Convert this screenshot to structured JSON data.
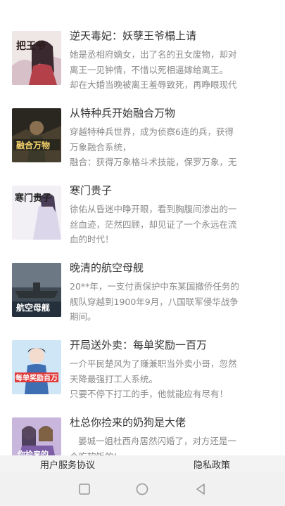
{
  "books": [
    {
      "title": "逆天毒妃：妖孽王爷榻上请",
      "desc": [
        "她是丞相府嫡女，出了名的丑女废物，却对",
        "离王一见钟情，不惜以死相逼嫁给离王。",
        "却在大婚当晚被离王羞辱致死，再睁眼现代"
      ],
      "cover_text": "把王爷"
    },
    {
      "title": "从特种兵开始融合万物",
      "desc": [
        "穿越特种兵世界，成为侦察6连的兵，获得",
        "万象融合系统，",
        "融合：获得万象格斗术技能，保罗万象，无"
      ],
      "cover_text": "融合万物"
    },
    {
      "title": "寒门贵子",
      "desc": [
        "徐佑从昏迷中睁开眼，看到胸腹间渗出的一",
        "丝血迹，茫然四顾，却见证了一个永远在流",
        "血的时代！"
      ],
      "cover_text": "寒门贵子"
    },
    {
      "title": "晚清的航空母舰",
      "desc": [
        "20**年，一支付责保护中东某国撤侨任务的",
        "舰队穿越到1900年9月，八国联军侵华战争",
        "期间。"
      ],
      "cover_text": "航空母舰"
    },
    {
      "title": "开局送外卖：每单奖励一百万",
      "desc": [
        "一介平民楚风为了赚兼职当外卖小哥，忽然",
        "天降最强打工人系统。",
        "只要不停下打工的手，他就能应有尽有！"
      ],
      "cover_text": "每单奖励百万"
    },
    {
      "title": "杜总你捡来的奶狗是大佬",
      "desc": [
        "晏城一姐杜西舟居然闪婚了，对方还是一",
        "个吃软饭的!"
      ],
      "cover_text": "你捡来的"
    }
  ],
  "footer": {
    "user_agreement": "用户服务协议",
    "privacy_policy": "隐私政策"
  },
  "colors": {
    "title": "#333333",
    "desc": "#8a8a8a",
    "footer_bg": "#f3f3f3",
    "nav_bg": "#f1f1f1"
  },
  "icons": [
    "square-recents-icon",
    "circle-home-icon",
    "triangle-back-icon"
  ]
}
